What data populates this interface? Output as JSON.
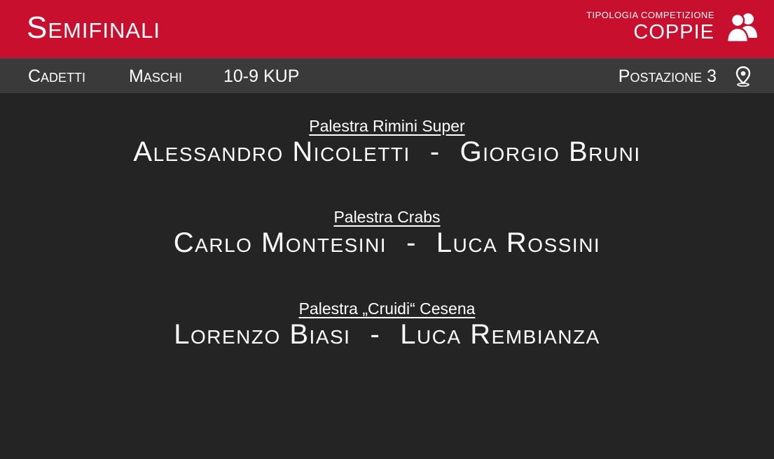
{
  "header": {
    "title": "Semifinali",
    "competition_type_label": "Tipologia competizione",
    "competition_type_value": "COPPIE",
    "icon": "users-icon"
  },
  "subbar": {
    "category": "Cadetti",
    "gender": "Maschi",
    "grade": "10-9 KUP",
    "station": "Postazione 3",
    "icon": "map-pin-icon"
  },
  "pairs": [
    {
      "gym": "Palestra Rimini Super",
      "athlete1": "Alessandro Nicoletti",
      "separator": "-",
      "athlete2": "Giorgio Bruni"
    },
    {
      "gym": "Palestra Crabs",
      "athlete1": "Carlo Montesini",
      "separator": "-",
      "athlete2": "Luca Rossini"
    },
    {
      "gym": "Palestra „Cruidi“ Cesena",
      "athlete1": "Lorenzo Biasi",
      "separator": "-",
      "athlete2": "Luca Rembianza"
    }
  ],
  "colors": {
    "header_bg": "#c8102e",
    "subbar_bg": "#3a3a3a",
    "body_bg": "#242424",
    "text": "#ffffff"
  }
}
